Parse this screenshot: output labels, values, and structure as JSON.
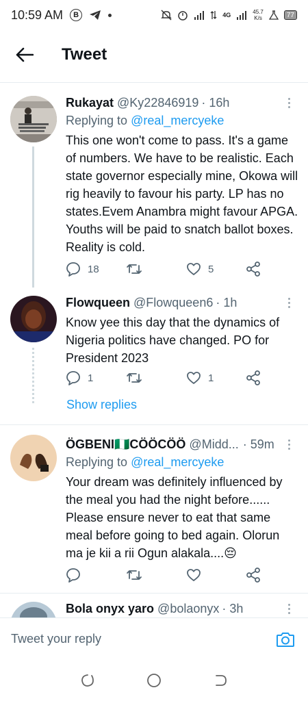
{
  "status_bar": {
    "time": "10:59 AM",
    "b_icon_label": "B",
    "network_speed_value": "45.7",
    "network_speed_unit": "K/s",
    "network_type": "4G",
    "battery": "77"
  },
  "header": {
    "title": "Tweet"
  },
  "tweets": [
    {
      "name": "Rukayat",
      "handle": "@Ky22846919",
      "time": "· 16h",
      "replying_prefix": "Replying to ",
      "replying_to": "@real_mercyeke",
      "text": "This one won't come to pass. It's a game of numbers. We have to be realistic. Each state governor especially mine, Okowa will rig heavily to favour his party. LP has no states.Evem Anambra might favour APGA. Youths will be paid to snatch ballot boxes. Reality is cold.",
      "replies": "18",
      "retweets": "",
      "likes": "5"
    },
    {
      "name": "Flowqueen",
      "handle": "@Flowqueen6",
      "time": "· 1h",
      "text": "Know yee this day that the dynamics of Nigeria politics have changed. PO for President 2023",
      "replies": "1",
      "retweets": "",
      "likes": "1",
      "show_replies": "Show replies"
    },
    {
      "name": "ÖGBENI🇳🇬CÖÖCÖÖ",
      "handle": "@Midd...",
      "time": "· 59m",
      "replying_prefix": "Replying to ",
      "replying_to": "@real_mercyeke",
      "text": "Your dream was definitely influenced by the meal you had the night before...... Please ensure never to eat that same meal before going to bed again.  Olorun ma je kii a rii Ogun alakala....😔",
      "replies": "",
      "retweets": "",
      "likes": ""
    },
    {
      "name": "Bola onyx yaro",
      "handle": "@bolaonyx",
      "time": "· 3h"
    }
  ],
  "reply_bar": {
    "placeholder": "Tweet your reply"
  },
  "colors": {
    "accent": "#1d9bf0",
    "secondary_text": "#536471",
    "divider": "#e6ecf0"
  },
  "icons": {
    "back": "arrow-left-icon",
    "reply": "comment-icon",
    "retweet": "retweet-icon",
    "like": "heart-icon",
    "share": "share-icon",
    "camera": "camera-icon"
  }
}
